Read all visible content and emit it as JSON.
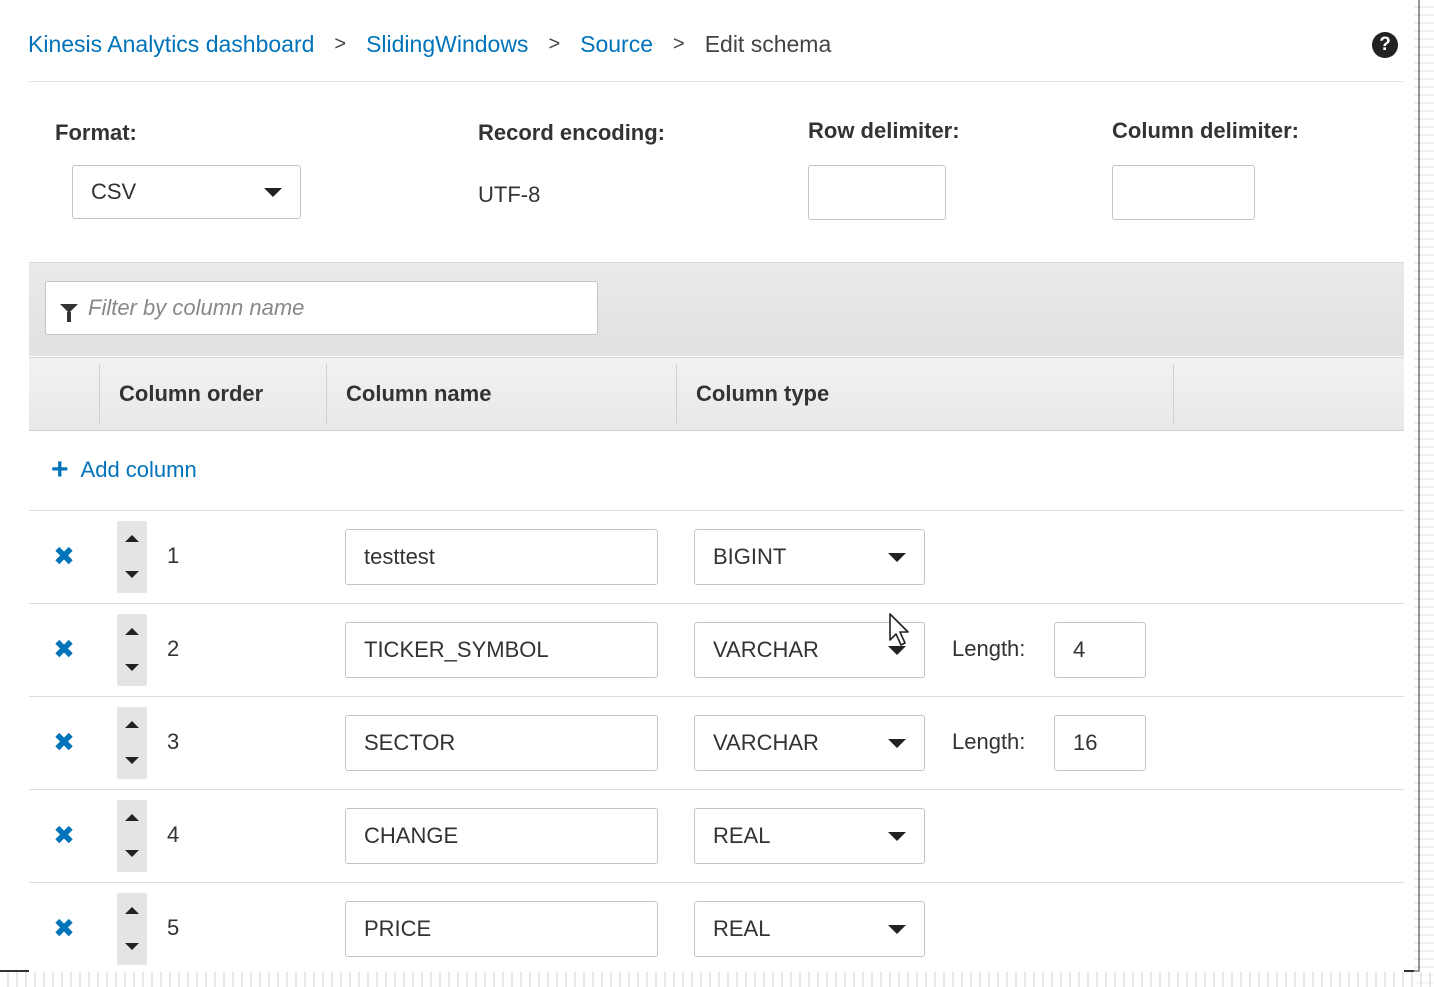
{
  "breadcrumb": {
    "items": [
      "Kinesis Analytics dashboard",
      "SlidingWindows",
      "Source"
    ],
    "separator": ">",
    "current": "Edit schema"
  },
  "help_icon": "question-circle-icon",
  "settings": {
    "format_label": "Format:",
    "format_value": "CSV",
    "record_encoding_label": "Record encoding:",
    "record_encoding_value": "UTF-8",
    "row_delimiter_label": "Row delimiter:",
    "row_delimiter_value": "",
    "column_delimiter_label": "Column delimiter:",
    "column_delimiter_value": ""
  },
  "filter": {
    "placeholder": "Filter by column name",
    "icon": "funnel-icon"
  },
  "table": {
    "headers": {
      "order": "Column order",
      "name": "Column name",
      "type": "Column type"
    },
    "add_column_label": "Add column",
    "length_label": "Length:",
    "rows": [
      {
        "order": "1",
        "name": "testtest",
        "type": "BIGINT",
        "length": null
      },
      {
        "order": "2",
        "name": "TICKER_SYMBOL",
        "type": "VARCHAR",
        "length": "4"
      },
      {
        "order": "3",
        "name": "SECTOR",
        "type": "VARCHAR",
        "length": "16"
      },
      {
        "order": "4",
        "name": "CHANGE",
        "type": "REAL",
        "length": null
      },
      {
        "order": "5",
        "name": "PRICE",
        "type": "REAL",
        "length": null
      }
    ]
  },
  "colors": {
    "link": "#0073bb",
    "header_bg": "#e8e8e8",
    "text": "#333333"
  }
}
